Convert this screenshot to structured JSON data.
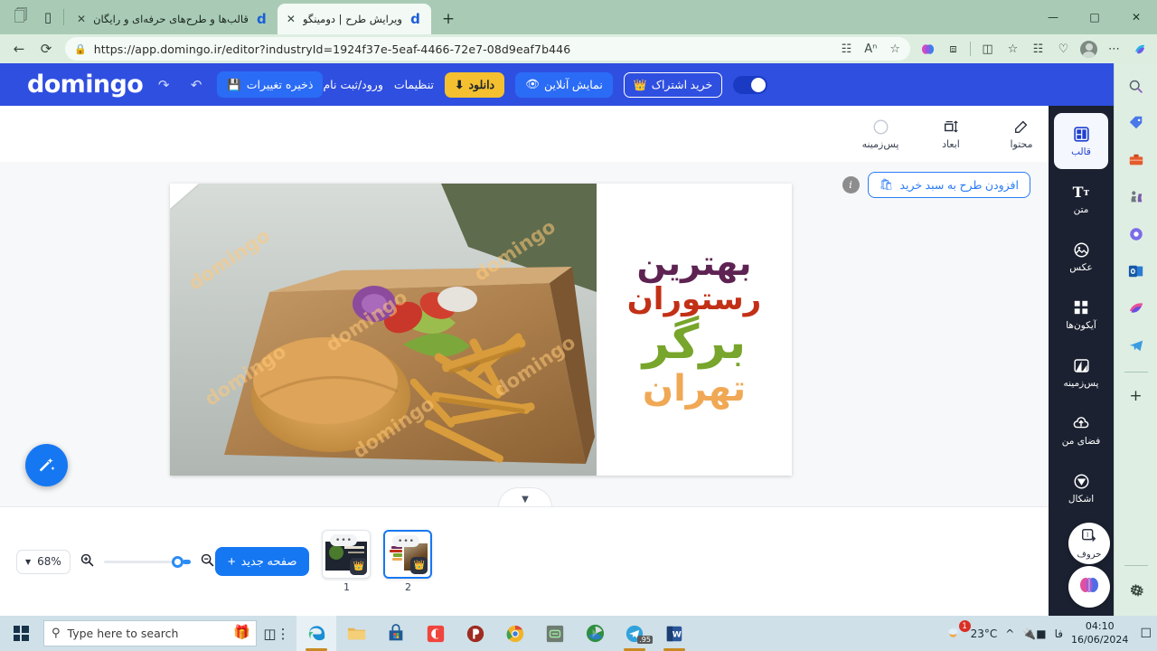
{
  "browser": {
    "tabs": [
      {
        "title": "قالب‌ها و طرح‌های حرفه‌ای و رایگان",
        "favicon": "d",
        "active": false
      },
      {
        "title": "ویرایش طرح | دومینگو",
        "favicon": "d",
        "active": true
      }
    ],
    "new_tab_label": "+",
    "url": "https://app.domingo.ir/editor?industryId=1924f37e-5eaf-4466-72e7-08d9eaf7b446",
    "nav": {
      "back": "←",
      "reload": "⟳"
    },
    "url_icons": [
      "split-screen-icon",
      "read-aloud-icon",
      "favorite-star-icon"
    ],
    "toolbar_icons": [
      "copilot-icon",
      "extensions-icon",
      "split-screen-icon",
      "favorites-icon",
      "collections-icon",
      "browser-essentials-icon",
      "profile-avatar",
      "settings-more-icon",
      "copilot-sidebar-icon"
    ],
    "window_controls": [
      "minimize",
      "maximize",
      "close"
    ],
    "sidebar_icons": [
      "search-icon",
      "shopping-tag-icon",
      "tools-icon",
      "games-icon",
      "designer-icon",
      "outlook-icon",
      "image-creator-icon",
      "telegram-icon",
      "add-icon",
      "settings-gear-icon"
    ]
  },
  "app_header": {
    "logo": "domingo",
    "save_label": "ذخیره تغییرات",
    "save_icon": "save-icon",
    "undo_icon": "undo-icon",
    "redo_icon": "redo-icon",
    "login_label": "ورود/ثبت نام",
    "settings_label": "تنظیمات",
    "download_label": "دانلود",
    "download_icon": "download-icon",
    "preview_label": "نمایش آنلاین",
    "preview_icon": "eye-icon",
    "subscribe_label": "خرید اشتراک",
    "subscribe_icon": "crown-icon",
    "dark_toggle_icon": "moon-icon"
  },
  "editor_toolbar": {
    "items": [
      {
        "label": "محتوا",
        "icon": "edit-content-icon"
      },
      {
        "label": "ابعاد",
        "icon": "dimensions-icon"
      },
      {
        "label": "پس‌زمینه",
        "icon": "background-circle-icon"
      }
    ]
  },
  "app_tools": {
    "items": [
      {
        "label": "قالب",
        "icon": "template-icon",
        "active": true
      },
      {
        "label": "متن",
        "icon": "text-icon",
        "active": false
      },
      {
        "label": "عکس",
        "icon": "image-icon",
        "active": false
      },
      {
        "label": "آیکون‌ها",
        "icon": "icons-grid-icon",
        "active": false
      },
      {
        "label": "پس‌زمینه",
        "icon": "background-icon",
        "active": false
      },
      {
        "label": "فضای من",
        "icon": "cloud-upload-icon",
        "active": false
      },
      {
        "label": "اشکال",
        "icon": "shapes-icon",
        "active": false
      },
      {
        "label": "حروف",
        "icon": "letters-icon",
        "active": false
      }
    ],
    "ai_button_icon": "ai-brain-icon"
  },
  "canvas": {
    "add_to_cart_label": "افزودن طرح به سبد خرید",
    "cart_icon": "cart-icon",
    "info_icon": "info-icon",
    "watermark": "domingo",
    "design_lines": [
      {
        "text": "بهترین",
        "color": "#5e2352"
      },
      {
        "text": "رستوران",
        "color": "#c23016"
      },
      {
        "text": "برگر",
        "color": "#78a52b"
      },
      {
        "text": "تهران",
        "color": "#f0a855"
      }
    ],
    "magic_button_icon": "magic-wand-icon",
    "collapse_icon": "chevron-down-icon"
  },
  "bottom_bar": {
    "zoom_level": "68%",
    "zoom_chevron": "chevron-down-icon",
    "zoom_in_icon": "zoom-in-icon",
    "zoom_out_icon": "zoom-out-icon",
    "new_page_label": "صفحه جدید",
    "new_page_icon": "plus-icon",
    "pages": [
      {
        "number": "1",
        "selected": false,
        "menu_icon": "more-dots-icon",
        "badge_icon": "crown-icon"
      },
      {
        "number": "2",
        "selected": true,
        "menu_icon": "more-dots-icon",
        "badge_icon": "crown-icon"
      }
    ]
  },
  "taskbar": {
    "start_icon": "windows-start-icon",
    "search_placeholder": "Type here to search",
    "search_icon": "search-icon",
    "gift_icon": "gift-icon",
    "task_view_icon": "task-view-icon",
    "apps": [
      {
        "name": "edge-icon",
        "open": true
      },
      {
        "name": "file-explorer-icon",
        "open": false
      },
      {
        "name": "microsoft-store-icon",
        "open": false
      },
      {
        "name": "camtasia-icon",
        "open": false
      },
      {
        "name": "potplayer-icon",
        "open": false
      },
      {
        "name": "chrome-icon",
        "open": false
      },
      {
        "name": "notepad-app-icon",
        "open": false
      },
      {
        "name": "idm-icon",
        "open": false
      },
      {
        "name": "telegram-icon",
        "open": true,
        "badge": ".95"
      },
      {
        "name": "word-icon",
        "open": true
      }
    ],
    "weather_temp": "23°C",
    "weather_icon": "weather-cloud-sun-icon",
    "tray_chevron": "show-hidden-icons-icon",
    "battery_icon": "battery-charging-icon",
    "language": "فا",
    "time": "04:10",
    "date": "16/06/2024",
    "notification_icon": "notifications-icon"
  }
}
